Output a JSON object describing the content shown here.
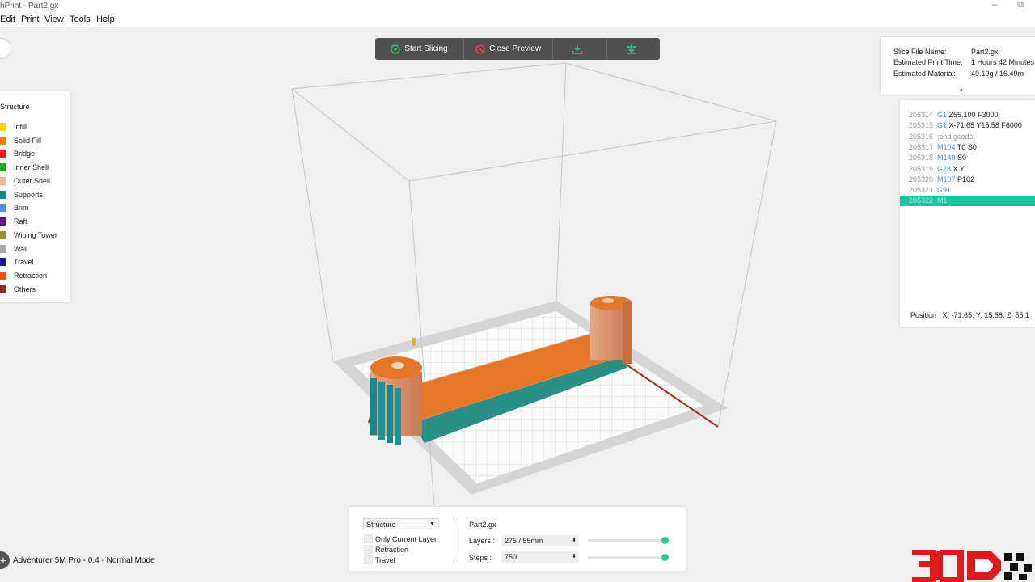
{
  "window": {
    "title": "hPrint - Part2.gx",
    "minimize": "–",
    "restore": "⧉"
  },
  "menu": [
    "Edit",
    "Print",
    "View",
    "Tools",
    "Help"
  ],
  "toolbar": {
    "start_slicing": "Start Slicing",
    "close_preview": "Close Preview",
    "download_icon": "download-icon",
    "print_icon": "send-to-printer-icon"
  },
  "legend": {
    "title": "Structure",
    "items": [
      {
        "label": "Infill",
        "color": "#ffd700"
      },
      {
        "label": "Solid Fill",
        "color": "#ff7a00"
      },
      {
        "label": "Bridge",
        "color": "#ff1a1a"
      },
      {
        "label": "Inner Shell",
        "color": "#1aa81a"
      },
      {
        "label": "Outer Shell",
        "color": "#f5b48c"
      },
      {
        "label": "Supports",
        "color": "#13888e"
      },
      {
        "label": "Brim",
        "color": "#4f8cf0"
      },
      {
        "label": "Raft",
        "color": "#5e1a7a"
      },
      {
        "label": "Wiping Tower",
        "color": "#9c9332"
      },
      {
        "label": "Wall",
        "color": "#a9a9a9"
      },
      {
        "label": "Travel",
        "color": "#1a1a8c"
      },
      {
        "label": "Retraction",
        "color": "#ff4a1a"
      },
      {
        "label": "Others",
        "color": "#8b2a2a"
      }
    ]
  },
  "slice_info": {
    "file_name_label": "Slice File Name:",
    "file_name": "Part2.gx",
    "print_time_label": "Estimated Print Time:",
    "print_time": "1 Hours 42 Minutes",
    "material_label": "Estimated Material:",
    "material": "49.19g / 16.49m",
    "expand_icon": "▾"
  },
  "gcode": [
    {
      "line": "205314",
      "cmd": "G1",
      "args": " Z55.100 F3000"
    },
    {
      "line": "205315",
      "cmd": "G1",
      "args": " X-71.65 Y15.58 F6000"
    },
    {
      "line": "205316",
      "cmd": "",
      "args": ";end gcode"
    },
    {
      "line": "205317",
      "cmd": "M104",
      "args": " T0 S0"
    },
    {
      "line": "205318",
      "cmd": "M140",
      "args": " S0"
    },
    {
      "line": "205319",
      "cmd": "G28",
      "args": " X Y"
    },
    {
      "line": "205320",
      "cmd": "M107",
      "args": " P102"
    },
    {
      "line": "205321",
      "cmd": "G91",
      "args": ""
    },
    {
      "line": "205322",
      "cmd": "M1",
      "args": ""
    }
  ],
  "position": {
    "label": "Position",
    "value": "X: -71.65, Y: 15.58, Z: 55.1"
  },
  "bottom": {
    "view_select": "Structure",
    "checkboxes": [
      "Only Current Layer",
      "Retraction",
      "Travel"
    ],
    "file": "Part2.gx",
    "layers_label": "Layers :",
    "layers_value": "275 / 55mm",
    "steps_label": "Steps :",
    "steps_value": "750",
    "layers_slider": 1.0,
    "steps_slider": 1.0
  },
  "status": {
    "printer_mode": "Adventurer 5M Pro - 0.4 - Normal Mode"
  },
  "colors": {
    "accent": "#14c99e",
    "toolbar": "#505050",
    "model_orange": "#e8762a",
    "support_teal": "#138a8e"
  }
}
